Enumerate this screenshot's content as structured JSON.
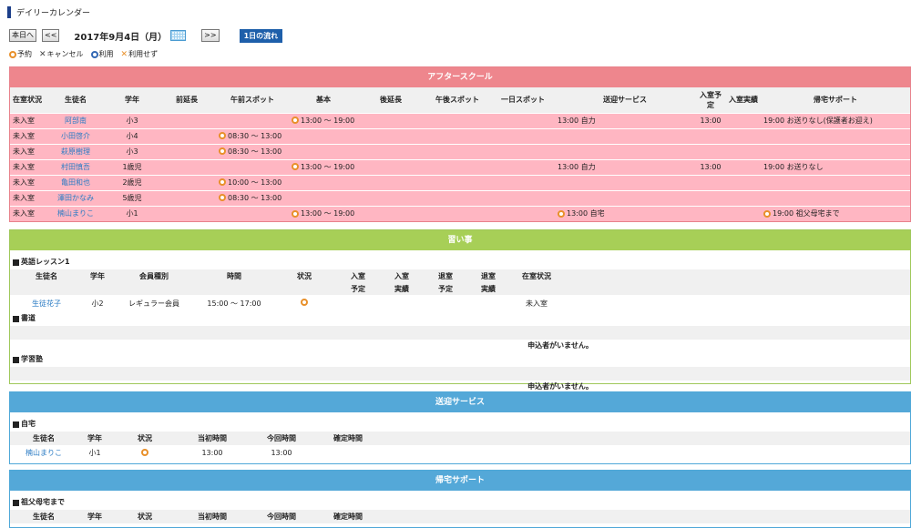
{
  "page": {
    "title": "デイリーカレンダー"
  },
  "nav": {
    "today": "本日へ",
    "prev": "<<",
    "date": "2017年9月4日（月）",
    "next": ">>",
    "flow": "1日の流れ"
  },
  "legend": [
    {
      "icon": "orange-circle",
      "label": "予約"
    },
    {
      "icon": "dark-cross",
      "label": "キャンセル"
    },
    {
      "icon": "blue-circle",
      "label": "利用"
    },
    {
      "icon": "orange-cross",
      "label": "利用せず"
    }
  ],
  "colors": {
    "after_header": "#ee868d",
    "after_row": "#ffb6c2",
    "lessons_header": "#a7cf57",
    "service_header": "#54a8d8",
    "link": "#2a7bc4",
    "reserve_circle": "#e8902a"
  },
  "after": {
    "title": "アフタースクール",
    "headers": {
      "status": "在室状況",
      "name": "生徒名",
      "grade": "学年",
      "pre": "前延長",
      "am": "午前スポット",
      "basic": "基本",
      "post": "後延長",
      "pm": "午後スポット",
      "day": "一日スポット",
      "send": "送迎サービス",
      "in_plan": "入室予定",
      "in_actual": "入室実績",
      "home": "帰宅サポート"
    },
    "rows": [
      {
        "status": "未入室",
        "name": "阿部南",
        "grade": "小3",
        "am": "",
        "basic": "13:00 ～ 19:00",
        "send": "13:00 自力",
        "in_plan": "13:00",
        "home": "19:00 お送りなし(保護者お迎え)"
      },
      {
        "status": "未入室",
        "name": "小田啓介",
        "grade": "小4",
        "am": "08:30 ～ 13:00",
        "basic": "",
        "send": "",
        "in_plan": "",
        "home": ""
      },
      {
        "status": "未入室",
        "name": "萩原樹理",
        "grade": "小3",
        "am": "08:30 ～ 13:00",
        "basic": "",
        "send": "",
        "in_plan": "",
        "home": ""
      },
      {
        "status": "未入室",
        "name": "村田慎吾",
        "grade": "1歳児",
        "am": "",
        "basic": "13:00 ～ 19:00",
        "send": "13:00 自力",
        "in_plan": "13:00",
        "home": "19:00 お送りなし"
      },
      {
        "status": "未入室",
        "name": "亀田和也",
        "grade": "2歳児",
        "am": "10:00 ～ 13:00",
        "basic": "",
        "send": "",
        "in_plan": "",
        "home": ""
      },
      {
        "status": "未入室",
        "name": "澤田かなみ",
        "grade": "5歳児",
        "am": "08:30 ～ 13:00",
        "basic": "",
        "send": "",
        "in_plan": "",
        "home": ""
      },
      {
        "status": "未入室",
        "name": "楠山まりこ",
        "grade": "小1",
        "am": "",
        "basic": "13:00 ～ 19:00",
        "send": "13:00 自宅",
        "in_plan": "",
        "home": "19:00 祖父母宅まで"
      }
    ]
  },
  "lessons": {
    "title": "習い事",
    "english": {
      "name": "英語レッスン1"
    },
    "headers": {
      "name": "生徒名",
      "grade": "学年",
      "member": "会員種別",
      "time": "時間",
      "status": "状況",
      "in": "入室",
      "plan": "予定",
      "actual": "実績",
      "out": "退室",
      "room": "在室状況"
    },
    "row": {
      "name": "生徒花子",
      "grade": "小2",
      "member": "レギュラー会員",
      "time": "15:00 ～ 17:00",
      "room": "未入室"
    },
    "calligraphy": {
      "name": "書道",
      "msg": "申込者がいません。"
    },
    "cram": {
      "name": "学習塾",
      "msg": "申込者がいません。"
    }
  },
  "service": {
    "title": "送迎サービス",
    "sub": "自宅",
    "headers": {
      "name": "生徒名",
      "grade": "学年",
      "status": "状況",
      "initial": "当初時間",
      "current": "今回時間",
      "confirmed": "確定時間"
    },
    "row": {
      "name": "楠山まりこ",
      "grade": "小1",
      "initial": "13:00",
      "current": "13:00"
    }
  },
  "home": {
    "title": "帰宅サポート",
    "sub": "祖父母宅まで",
    "headers": {
      "name": "生徒名",
      "grade": "学年",
      "status": "状況",
      "initial": "当初時間",
      "current": "今回時間",
      "confirmed": "確定時間"
    }
  }
}
